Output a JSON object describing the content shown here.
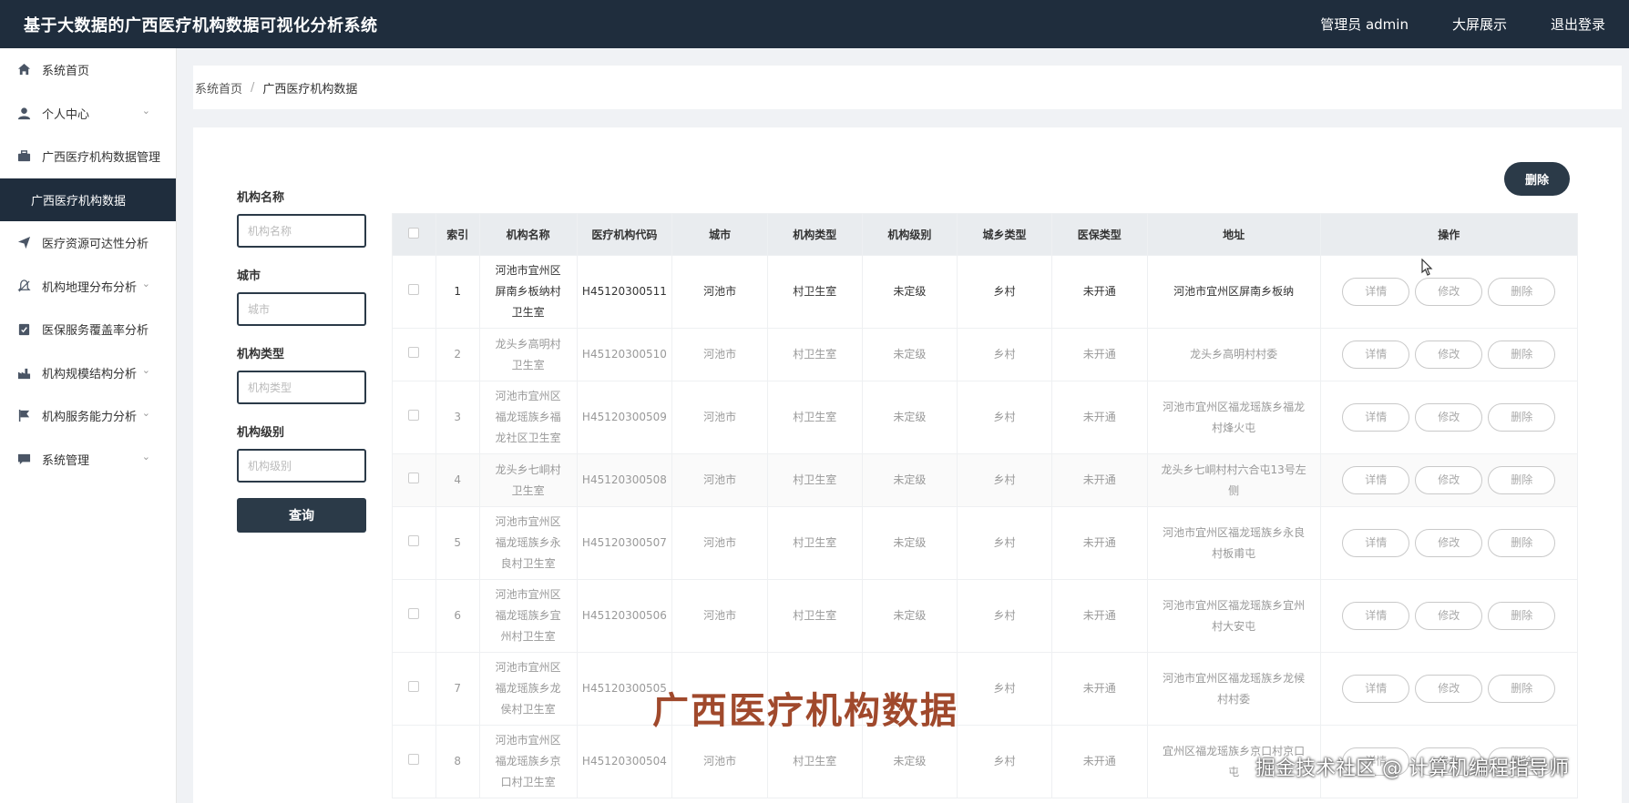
{
  "header": {
    "app_title": "基于大数据的广西医疗机构数据可视化分析系统",
    "user_label": "管理员 admin",
    "big_screen_label": "大屏展示",
    "logout_label": "退出登录"
  },
  "sidebar": {
    "items": [
      {
        "label": "系统首页",
        "icon": "home-icon"
      },
      {
        "label": "个人中心",
        "icon": "user-icon",
        "chevron": "⌄"
      },
      {
        "label": "广西医疗机构数据管理",
        "icon": "briefcase-icon"
      },
      {
        "label": "广西医疗机构数据",
        "active": true
      },
      {
        "label": "医疗资源可达性分析",
        "icon": "send-icon"
      },
      {
        "label": "机构地理分布分析",
        "icon": "bell-off-icon",
        "chevron": "⌄"
      },
      {
        "label": "医保服务覆盖率分析",
        "icon": "clipboard-icon"
      },
      {
        "label": "机构规模结构分析",
        "icon": "factory-icon",
        "chevron": "⌄"
      },
      {
        "label": "机构服务能力分析",
        "icon": "flag-icon",
        "chevron": "⌄"
      },
      {
        "label": "系统管理",
        "icon": "message-icon",
        "chevron": "⌄"
      }
    ]
  },
  "breadcrumb": {
    "home": "系统首页",
    "separator": "/",
    "current": "广西医疗机构数据"
  },
  "filters": {
    "name_label": "机构名称",
    "name_placeholder": "机构名称",
    "city_label": "城市",
    "city_placeholder": "城市",
    "type_label": "机构类型",
    "type_placeholder": "机构类型",
    "level_label": "机构级别",
    "level_placeholder": "机构级别",
    "query_label": "查询"
  },
  "toolbar": {
    "delete_label": "删除"
  },
  "table": {
    "headers": [
      "索引",
      "机构名称",
      "医疗机构代码",
      "城市",
      "机构类型",
      "机构级别",
      "城乡类型",
      "医保类型",
      "地址",
      "操作"
    ],
    "op_labels": {
      "detail": "详情",
      "edit": "修改",
      "delete": "删除"
    },
    "rows": [
      {
        "index": "1",
        "name": "河池市宜州区屏南乡板纳村卫生室",
        "code": "H45120300511",
        "city": "河池市",
        "type": "村卫生室",
        "level": "未定级",
        "area": "乡村",
        "insurance": "未开通",
        "address": "河池市宜州区屏南乡板纳"
      },
      {
        "index": "2",
        "name": "龙头乡高明村卫生室",
        "code": "H45120300510",
        "city": "河池市",
        "type": "村卫生室",
        "level": "未定级",
        "area": "乡村",
        "insurance": "未开通",
        "address": "龙头乡高明村村委"
      },
      {
        "index": "3",
        "name": "河池市宜州区福龙瑶族乡福龙社区卫生室",
        "code": "H45120300509",
        "city": "河池市",
        "type": "村卫生室",
        "level": "未定级",
        "area": "乡村",
        "insurance": "未开通",
        "address": "河池市宜州区福龙瑶族乡福龙村烽火屯"
      },
      {
        "index": "4",
        "name": "龙头乡七峒村卫生室",
        "code": "H45120300508",
        "city": "河池市",
        "type": "村卫生室",
        "level": "未定级",
        "area": "乡村",
        "insurance": "未开通",
        "address": "龙头乡七峒村村六合屯13号左侧"
      },
      {
        "index": "5",
        "name": "河池市宜州区福龙瑶族乡永良村卫生室",
        "code": "H45120300507",
        "city": "河池市",
        "type": "村卫生室",
        "level": "未定级",
        "area": "乡村",
        "insurance": "未开通",
        "address": "河池市宜州区福龙瑶族乡永良村板甫屯"
      },
      {
        "index": "6",
        "name": "河池市宜州区福龙瑶族乡宜州村卫生室",
        "code": "H45120300506",
        "city": "河池市",
        "type": "村卫生室",
        "level": "未定级",
        "area": "乡村",
        "insurance": "未开通",
        "address": "河池市宜州区福龙瑶族乡宜州村大安屯"
      },
      {
        "index": "7",
        "name": "河池市宜州区福龙瑶族乡龙侯村卫生室",
        "code": "H45120300505",
        "city": "",
        "type": "",
        "level": "",
        "area": "乡村",
        "insurance": "未开通",
        "address": "河池市宜州区福龙瑶族乡龙候村村委"
      },
      {
        "index": "8",
        "name": "河池市宜州区福龙瑶族乡京口村卫生室",
        "code": "H45120300504",
        "city": "河池市",
        "type": "村卫生室",
        "level": "未定级",
        "area": "乡村",
        "insurance": "未开通",
        "address": "宜州区福龙瑶族乡京口村京口屯"
      }
    ]
  },
  "overlay": {
    "title": "广西医疗机构数据",
    "watermark": "掘金技术社区 @ 计算机编程指导师"
  }
}
